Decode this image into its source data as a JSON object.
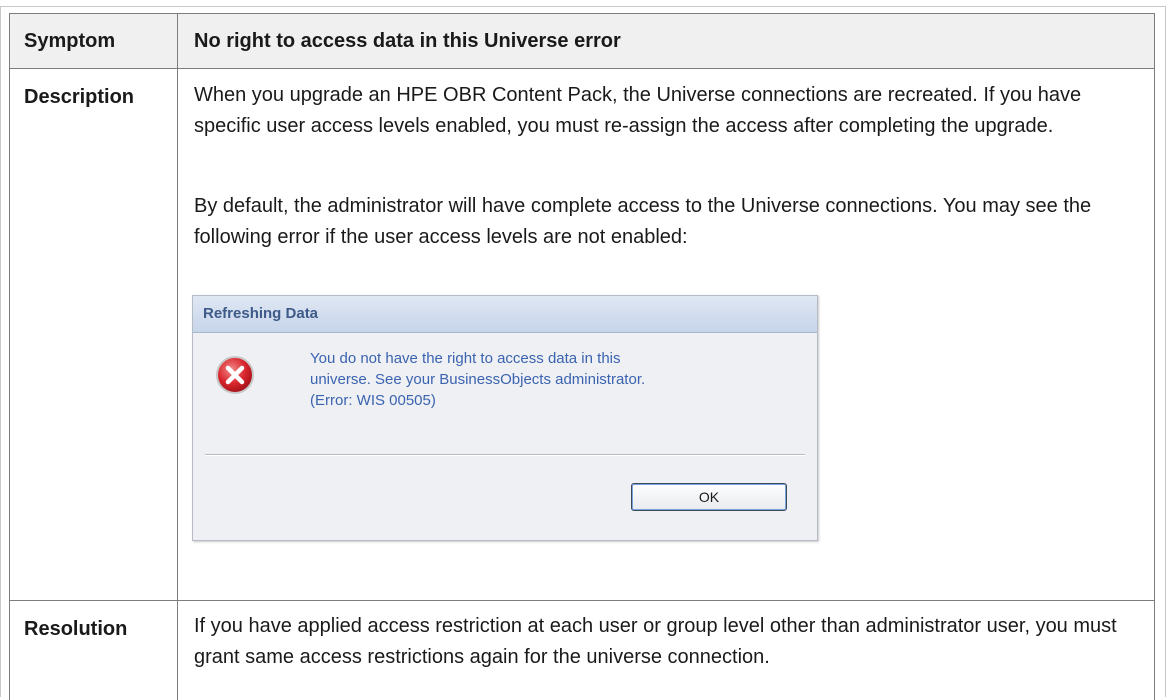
{
  "table": {
    "symptom_label": "Symptom",
    "symptom_text": "No right to access data in this Universe error",
    "description_label": "Description",
    "description_paragraphs": [
      "When you upgrade an HPE OBR Content Pack, the Universe connections are recreated. If you have specific user access levels enabled, you must re-assign the access after completing the upgrade.",
      "By default, the administrator will have complete access to the Universe connections. You may see the following error if the user access levels are not enabled:"
    ],
    "resolution_label": "Resolution",
    "resolution_text": "If you have applied access restriction at each user or group level other than administrator user, you must grant same access restrictions again for the universe connection."
  },
  "dialog": {
    "title": "Refreshing Data",
    "message_lines": [
      "You do not have the right to access data in this",
      "universe. See your BusinessObjects administrator.",
      "(Error: WIS 00505)"
    ],
    "ok_label": "OK",
    "icon": "error-icon",
    "colors": {
      "title_text": "#3d5a88",
      "message_text": "#3b63b0",
      "icon_red": "#d8262c"
    }
  }
}
